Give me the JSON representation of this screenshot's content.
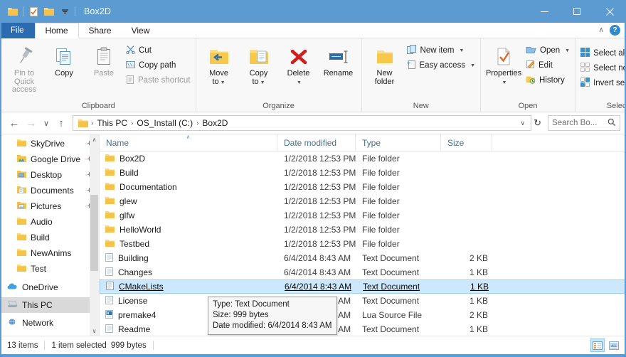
{
  "window": {
    "title": "Box2D",
    "quick_access": [
      {
        "name": "folder-icon",
        "glyph": "▮"
      },
      {
        "name": "properties-icon",
        "glyph": "▮"
      },
      {
        "name": "new-folder-icon",
        "glyph": "▮"
      },
      {
        "name": "chevron-down-icon",
        "glyph": "▾"
      }
    ],
    "controls": {
      "minimize": "–",
      "maximize": "□",
      "close": "✕"
    },
    "accent_color": "#5b9bd1"
  },
  "ribbon": {
    "tabs": [
      {
        "label": "File",
        "kind": "file"
      },
      {
        "label": "Home",
        "kind": "active"
      },
      {
        "label": "Share",
        "kind": "normal"
      },
      {
        "label": "View",
        "kind": "normal"
      }
    ],
    "collapse_icon": "∧",
    "help_label": "?",
    "groups": [
      {
        "label": "Clipboard",
        "big": [
          {
            "label": "Pin to Quick\naccess",
            "line1": "Pin to Quick",
            "line2": "access",
            "dim": true,
            "icon": "pin-icon"
          },
          {
            "label": "Copy",
            "line1": "Copy",
            "line2": "",
            "dim": false,
            "icon": "copy-icon"
          },
          {
            "label": "Paste",
            "line1": "Paste",
            "line2": "",
            "dim": true,
            "icon": "paste-icon"
          }
        ],
        "small": [
          {
            "label": "Cut",
            "icon": "scissors-icon",
            "dim": false,
            "caret": false
          },
          {
            "label": "Copy path",
            "icon": "copy-path-icon",
            "dim": false,
            "caret": false
          },
          {
            "label": "Paste shortcut",
            "icon": "paste-shortcut-icon",
            "dim": true,
            "caret": false
          }
        ]
      },
      {
        "label": "Organize",
        "big": [
          {
            "line1": "Move",
            "line2": "to",
            "dim": false,
            "icon": "move-to-icon",
            "caret": true
          },
          {
            "line1": "Copy",
            "line2": "to",
            "dim": false,
            "icon": "copy-to-icon",
            "caret": true
          },
          {
            "line1": "Delete",
            "line2": "",
            "dim": false,
            "icon": "delete-icon",
            "caret": true
          },
          {
            "line1": "Rename",
            "line2": "",
            "dim": false,
            "icon": "rename-icon",
            "caret": false
          }
        ],
        "small": []
      },
      {
        "label": "New",
        "big": [
          {
            "line1": "New",
            "line2": "folder",
            "dim": false,
            "icon": "new-folder-icon",
            "caret": false
          }
        ],
        "small": [
          {
            "label": "New item",
            "icon": "new-item-icon",
            "dim": false,
            "caret": true
          },
          {
            "label": "Easy access",
            "icon": "easy-access-icon",
            "dim": false,
            "caret": true
          }
        ]
      },
      {
        "label": "Open",
        "big": [
          {
            "line1": "Properties",
            "line2": "",
            "dim": false,
            "icon": "properties-icon",
            "caret": true
          }
        ],
        "small": [
          {
            "label": "Open",
            "icon": "open-icon",
            "dim": false,
            "caret": true
          },
          {
            "label": "Edit",
            "icon": "edit-icon",
            "dim": false,
            "caret": false
          },
          {
            "label": "History",
            "icon": "history-icon",
            "dim": false,
            "caret": false
          }
        ]
      },
      {
        "label": "Select",
        "big": [],
        "small": [
          {
            "label": "Select all",
            "icon": "select-all-icon",
            "dim": false,
            "caret": false
          },
          {
            "label": "Select none",
            "icon": "select-none-icon",
            "dim": false,
            "caret": false
          },
          {
            "label": "Invert selection",
            "icon": "invert-selection-icon",
            "dim": false,
            "caret": false
          }
        ]
      }
    ]
  },
  "address_bar": {
    "back_icon": "←",
    "forward_icon": "→",
    "recent_icon": "∨",
    "up_icon": "↑",
    "folder_icon": "folder-icon",
    "breadcrumbs": [
      "This PC",
      "OS_Install (C:)",
      "Box2D"
    ],
    "separator": "›",
    "dropdown_icon": "∨",
    "refresh_icon": "↻",
    "search_placeholder": "Search Bo...",
    "search_value": "",
    "search_icon": "search-icon"
  },
  "sidebar": {
    "items": [
      {
        "label": "SkyDrive",
        "icon": "folder-icon",
        "pinned": true,
        "level": 1,
        "selected": false
      },
      {
        "label": "Google Drive",
        "icon": "google-drive-icon",
        "pinned": true,
        "level": 1,
        "selected": false
      },
      {
        "label": "Desktop",
        "icon": "desktop-folder-icon",
        "pinned": true,
        "level": 1,
        "selected": false
      },
      {
        "label": "Documents",
        "icon": "documents-folder-icon",
        "pinned": true,
        "level": 1,
        "selected": false
      },
      {
        "label": "Pictures",
        "icon": "pictures-folder-icon",
        "pinned": true,
        "level": 1,
        "selected": false
      },
      {
        "label": "Audio",
        "icon": "folder-icon",
        "pinned": false,
        "level": 1,
        "selected": false
      },
      {
        "label": "Build",
        "icon": "folder-icon",
        "pinned": false,
        "level": 1,
        "selected": false
      },
      {
        "label": "NewAnims",
        "icon": "folder-icon",
        "pinned": false,
        "level": 1,
        "selected": false
      },
      {
        "label": "Test",
        "icon": "folder-icon",
        "pinned": false,
        "level": 1,
        "selected": false
      },
      {
        "label": "OneDrive",
        "icon": "onedrive-icon",
        "pinned": false,
        "level": 0,
        "selected": false
      },
      {
        "label": "This PC",
        "icon": "this-pc-icon",
        "pinned": false,
        "level": 0,
        "selected": true
      },
      {
        "label": "Network",
        "icon": "network-icon",
        "pinned": false,
        "level": 0,
        "selected": false
      }
    ],
    "scroll_up_icon": "∧",
    "scroll_down_icon": "∨"
  },
  "file_list": {
    "columns": [
      {
        "key": "name",
        "label": "Name",
        "sorted": true,
        "sort_icon": "∧"
      },
      {
        "key": "date",
        "label": "Date modified",
        "sorted": false,
        "sort_icon": ""
      },
      {
        "key": "type",
        "label": "Type",
        "sorted": false,
        "sort_icon": ""
      },
      {
        "key": "size",
        "label": "Size",
        "sorted": false,
        "sort_icon": ""
      }
    ],
    "rows": [
      {
        "name": "Box2D",
        "date": "1/2/2018 12:53 PM",
        "type": "File folder",
        "size": "",
        "icon": "folder-icon",
        "selected": false
      },
      {
        "name": "Build",
        "date": "1/2/2018 12:53 PM",
        "type": "File folder",
        "size": "",
        "icon": "folder-icon",
        "selected": false
      },
      {
        "name": "Documentation",
        "date": "1/2/2018 12:53 PM",
        "type": "File folder",
        "size": "",
        "icon": "folder-icon",
        "selected": false
      },
      {
        "name": "glew",
        "date": "1/2/2018 12:53 PM",
        "type": "File folder",
        "size": "",
        "icon": "folder-icon",
        "selected": false
      },
      {
        "name": "glfw",
        "date": "1/2/2018 12:53 PM",
        "type": "File folder",
        "size": "",
        "icon": "folder-icon",
        "selected": false
      },
      {
        "name": "HelloWorld",
        "date": "1/2/2018 12:53 PM",
        "type": "File folder",
        "size": "",
        "icon": "folder-icon",
        "selected": false
      },
      {
        "name": "Testbed",
        "date": "1/2/2018 12:53 PM",
        "type": "File folder",
        "size": "",
        "icon": "folder-icon",
        "selected": false
      },
      {
        "name": "Building",
        "date": "6/4/2014 8:43 AM",
        "type": "Text Document",
        "size": "2 KB",
        "icon": "text-document-icon",
        "selected": false
      },
      {
        "name": "Changes",
        "date": "6/4/2014 8:43 AM",
        "type": "Text Document",
        "size": "1 KB",
        "icon": "text-document-icon",
        "selected": false
      },
      {
        "name": "CMakeLists",
        "date": "6/4/2014 8:43 AM",
        "type": "Text Document",
        "size": "1 KB",
        "icon": "text-document-icon",
        "selected": true
      },
      {
        "name": "License",
        "date": "6/4/2014 8:43 AM",
        "type": "Text Document",
        "size": "1 KB",
        "icon": "text-document-icon",
        "selected": false
      },
      {
        "name": "premake4",
        "date": "6/4/2014 8:43 AM",
        "type": "Lua Source File",
        "size": "2 KB",
        "icon": "lua-source-icon",
        "selected": false
      },
      {
        "name": "Readme",
        "date": "6/4/2014 8:43 AM",
        "type": "Text Document",
        "size": "1 KB",
        "icon": "text-document-icon",
        "selected": false
      }
    ]
  },
  "tooltip": {
    "line1": "Type: Text Document",
    "line2": "Size: 999 bytes",
    "line3": "Date modified: 6/4/2014 8:43 AM"
  },
  "status_bar": {
    "item_count": "13 items",
    "selection": "1 item selected",
    "selection_size": "999 bytes",
    "views": [
      {
        "name": "details-view-button",
        "active": true
      },
      {
        "name": "large-icons-view-button",
        "active": false
      }
    ]
  }
}
